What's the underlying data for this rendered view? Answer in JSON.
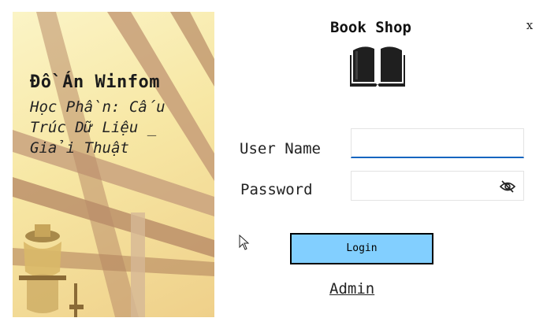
{
  "side_panel": {
    "project_title": "Đồ Án Winfom",
    "course_lines": [
      "Học Phần: Cấu",
      "Trúc Dữ Liệu _",
      "Giải Thuật"
    ]
  },
  "header": {
    "title": "Book Shop",
    "close_label": "x",
    "logo_icon": "open-book-icon"
  },
  "form": {
    "username_label": "User Name",
    "username_value": "",
    "password_label": "Password",
    "password_value": "",
    "password_toggle_icon": "eye-slash-icon",
    "login_label": "Login",
    "admin_label": "Admin"
  },
  "colors": {
    "login_button_bg": "#82cfff",
    "focus_underline": "#1565c0"
  }
}
